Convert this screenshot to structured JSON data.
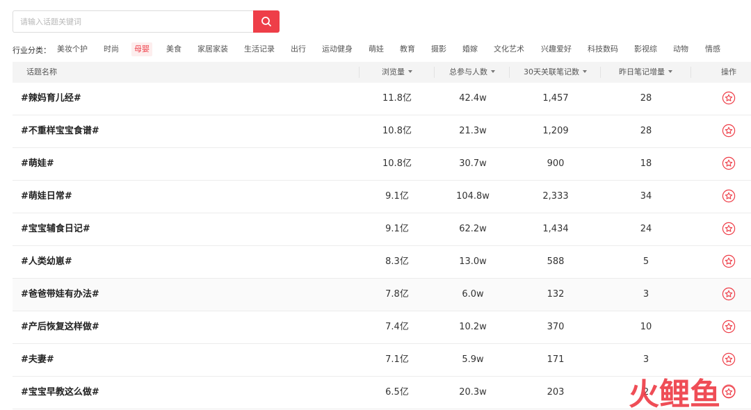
{
  "search": {
    "placeholder": "请输入话题关键词",
    "value": ""
  },
  "filter": {
    "label": "行业分类：",
    "tags": [
      "美妆个护",
      "时尚",
      "母婴",
      "美食",
      "家居家装",
      "生活记录",
      "出行",
      "运动健身",
      "萌娃",
      "教育",
      "摄影",
      "婚嫁",
      "文化艺术",
      "兴趣爱好",
      "科技数码",
      "影视综",
      "动物",
      "情感"
    ],
    "active": "母婴"
  },
  "table": {
    "headers": [
      "话题名称",
      "浏览量",
      "总参与人数",
      "30天关联笔记数",
      "昨日笔记增量",
      "操作"
    ],
    "rows": [
      {
        "name": "#辣妈育儿经#",
        "views": "11.8亿",
        "participants": "42.4w",
        "notes30": "1,457",
        "yesterday": "28"
      },
      {
        "name": "#不重样宝宝食谱#",
        "views": "10.8亿",
        "participants": "21.3w",
        "notes30": "1,209",
        "yesterday": "28"
      },
      {
        "name": "#萌娃#",
        "views": "10.8亿",
        "participants": "30.7w",
        "notes30": "900",
        "yesterday": "18"
      },
      {
        "name": "#萌娃日常#",
        "views": "9.1亿",
        "participants": "104.8w",
        "notes30": "2,333",
        "yesterday": "34"
      },
      {
        "name": "#宝宝辅食日记#",
        "views": "9.1亿",
        "participants": "62.2w",
        "notes30": "1,434",
        "yesterday": "24"
      },
      {
        "name": "#人类幼崽#",
        "views": "8.3亿",
        "participants": "13.0w",
        "notes30": "588",
        "yesterday": "5"
      },
      {
        "name": "#爸爸带娃有办法#",
        "views": "7.8亿",
        "participants": "6.0w",
        "notes30": "132",
        "yesterday": "3"
      },
      {
        "name": "#产后恢复这样做#",
        "views": "7.4亿",
        "participants": "10.2w",
        "notes30": "370",
        "yesterday": "10"
      },
      {
        "name": "#夫妻#",
        "views": "7.1亿",
        "participants": "5.9w",
        "notes30": "171",
        "yesterday": "3"
      },
      {
        "name": "#宝宝早教这么做#",
        "views": "6.5亿",
        "participants": "20.3w",
        "notes30": "203",
        "yesterday": "2"
      }
    ]
  },
  "watermark": {
    "text": "火鲤鱼"
  },
  "colors": {
    "accent": "#ee3e48",
    "header_bg": "#f4f4f4",
    "active_tag_bg": "#fdeeee"
  },
  "icons": {
    "search": "search-icon",
    "favorite": "star-circle-icon"
  }
}
